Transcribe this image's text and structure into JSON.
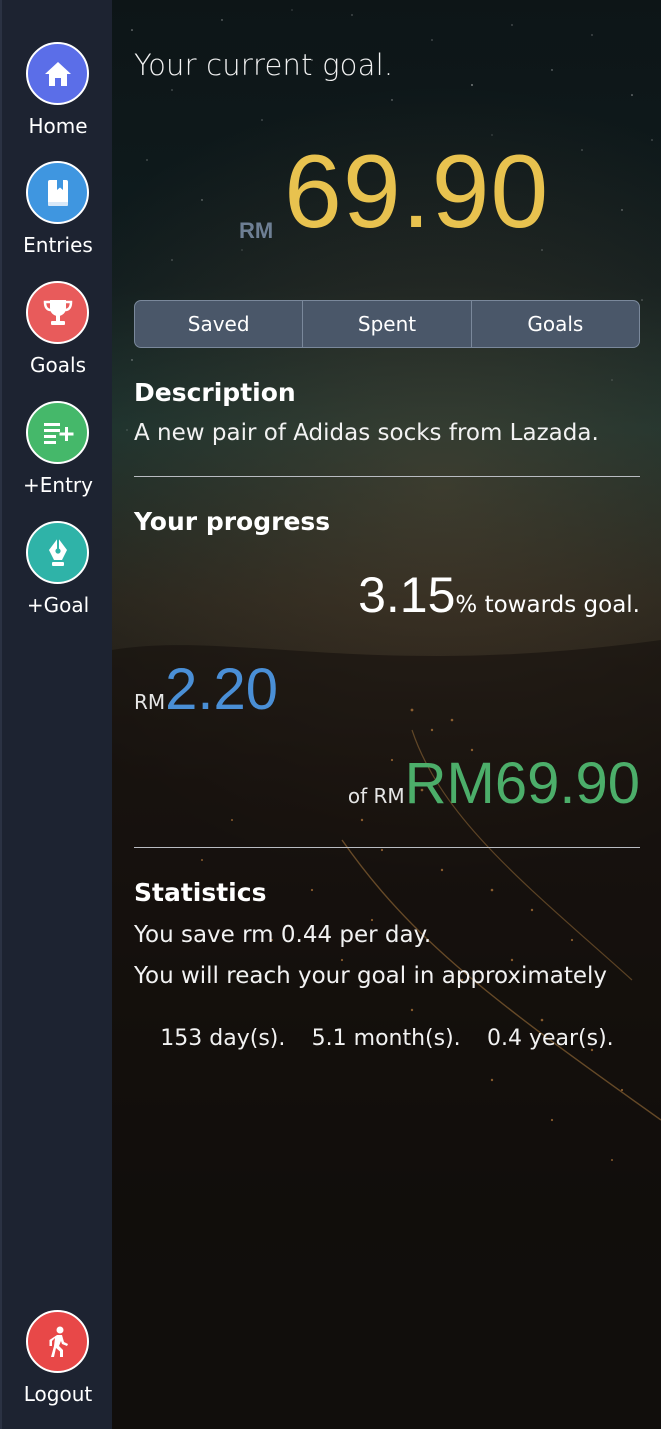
{
  "sidebar": {
    "items": [
      {
        "label": "Home",
        "color": "#5b6ee8",
        "icon": "home-icon"
      },
      {
        "label": "Entries",
        "color": "#3f96e0",
        "icon": "book-icon"
      },
      {
        "label": "Goals",
        "color": "#e85b5b",
        "icon": "trophy-icon"
      },
      {
        "label": "+Entry",
        "color": "#45b86a",
        "icon": "add-list-icon"
      },
      {
        "label": "+Goal",
        "color": "#2fb3a8",
        "icon": "pen-nib-icon"
      }
    ],
    "logout": {
      "label": "Logout",
      "color": "#e84848",
      "icon": "walking-person-icon"
    }
  },
  "goal": {
    "heading": "Your current goal.",
    "currency": "RM",
    "amount": "69.90",
    "amount_color": "#e8c24f"
  },
  "tabs": [
    "Saved",
    "Spent",
    "Goals"
  ],
  "description": {
    "title": "Description",
    "text": "A new pair of Adidas socks from Lazada."
  },
  "progress": {
    "title": "Your progress",
    "percent": "3.15",
    "percent_suffix": "% towards goal.",
    "saved_currency": "RM",
    "saved_amount": "2.20",
    "saved_color": "#4a8fd6",
    "target_prefix": "of RM",
    "target_amount": "RM69.90",
    "target_color": "#4cae6a"
  },
  "statistics": {
    "title": "Statistics",
    "per_day": "You save rm 0.44 per day.",
    "reach_text": "You will reach your goal in approximately",
    "days": "153 day(s).",
    "months": "5.1 month(s).",
    "years": "0.4 year(s)."
  }
}
